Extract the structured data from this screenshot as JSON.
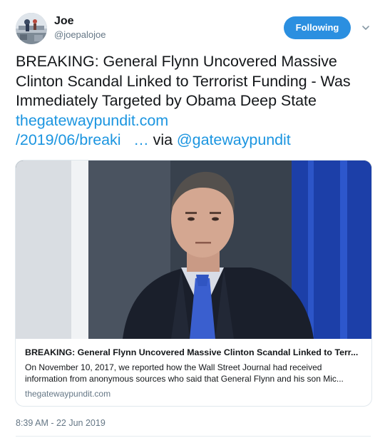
{
  "user": {
    "display_name": "Joe",
    "handle": "@joepalojoe"
  },
  "follow_button": {
    "label": "Following"
  },
  "icons": {
    "menu": "chevron-down-icon"
  },
  "tweet": {
    "text_main": "BREAKING: General Flynn Uncovered Massive Clinton Scandal Linked to Terrorist Funding - Was Immediately Targeted by Obama Deep State ",
    "link_part1": "thegatewaypundit.com",
    "link_part2": "/2019/06/breaki",
    "link_ellipsis": "…",
    "via_text": " via ",
    "mention": "@gatewaypundit"
  },
  "card": {
    "title": "BREAKING: General Flynn Uncovered Massive Clinton Scandal Linked to Terr...",
    "description_line1": "On November 10, 2017, we reported how the Wall Street Journal had received",
    "description_line2": "information from anonymous sources who said that General Flynn and his son Mic...",
    "domain": "thegatewaypundit.com"
  },
  "timestamp": "8:39 AM - 22 Jun 2019",
  "colors": {
    "accent": "#1b95e0",
    "follow_button_bg": "#2b8fe0",
    "secondary_text": "#657786"
  }
}
